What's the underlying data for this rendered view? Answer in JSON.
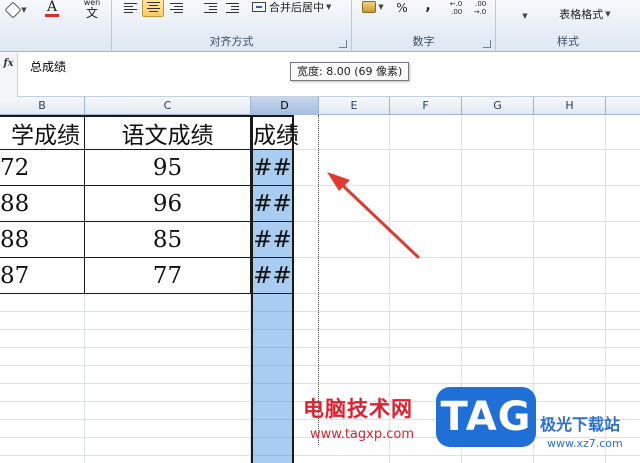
{
  "ribbon": {
    "font": {
      "fill_color_icon": "fill-color-icon",
      "font_color_letter": "A",
      "font_color": "#e02a2a",
      "wen_label_top": "wén",
      "wen_label": "文"
    },
    "alignment": {
      "group_label": "对齐方式",
      "merge_label": "合并后居中"
    },
    "number": {
      "group_label": "数字",
      "percent": "%",
      "comma": ",",
      "inc_decimal": "←.0\n.00",
      "dec_decimal": ".00\n→.0"
    },
    "styles": {
      "group_label": "样式",
      "table_format_label": "表格格式"
    }
  },
  "formula_bar": {
    "fx": "fx",
    "content": "总成绩"
  },
  "tooltip": "宽度: 8.00 (69 像素)",
  "columns": [
    "B",
    "C",
    "D",
    "E",
    "F",
    "G",
    "H"
  ],
  "table": {
    "headers": {
      "b": "学成绩",
      "c": "语文成绩",
      "d": "成绩"
    },
    "rows": [
      {
        "b": "72",
        "c": "95",
        "d": "##"
      },
      {
        "b": "88",
        "c": "96",
        "d": "##"
      },
      {
        "b": "88",
        "c": "85",
        "d": "##"
      },
      {
        "b": "87",
        "c": "77",
        "d": "##"
      }
    ]
  },
  "annotation": {
    "arrow_color": "#e03a2e"
  },
  "watermark": {
    "cn_text": "电脑技术网",
    "url": "www.tagxp.com",
    "tag": "TAG",
    "site": "极光下载站",
    "site_url": "www.xz7.com"
  }
}
